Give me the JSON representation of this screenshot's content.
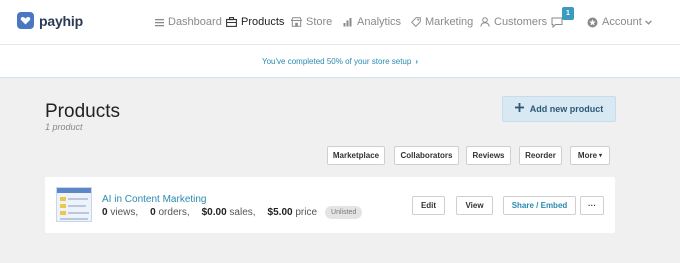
{
  "brand": {
    "name": "payhip"
  },
  "nav": {
    "items": [
      {
        "label": "Dashboard",
        "icon": "list-icon"
      },
      {
        "label": "Products",
        "icon": "products-icon"
      },
      {
        "label": "Store",
        "icon": "store-icon"
      },
      {
        "label": "Analytics",
        "icon": "analytics-icon"
      },
      {
        "label": "Marketing",
        "icon": "tag-icon"
      },
      {
        "label": "Customers",
        "icon": "user-icon"
      }
    ],
    "notifications_count": "1",
    "account_label": "Account"
  },
  "banner": {
    "text": "You've completed 50% of your store setup",
    "chevron": "›"
  },
  "page": {
    "title": "Products",
    "subtitle": "1 product",
    "add_button": "Add new product",
    "toolbar": [
      "Marketplace",
      "Collaborators",
      "Reviews",
      "Reorder",
      "More"
    ]
  },
  "products": [
    {
      "name": "AI in Content Marketing",
      "views": "0",
      "views_label": "views,",
      "orders": "0",
      "orders_label": "orders,",
      "sales": "$0.00",
      "sales_label": "sales,",
      "price": "$5.00",
      "price_label": "price",
      "status": "Unlisted",
      "actions": [
        "Edit",
        "View",
        "Share / Embed",
        "···"
      ]
    }
  ],
  "colors": {
    "accent": "#2a8bb0",
    "brand": "#4a76c4",
    "button_primary_bg": "#d9e9f3"
  }
}
